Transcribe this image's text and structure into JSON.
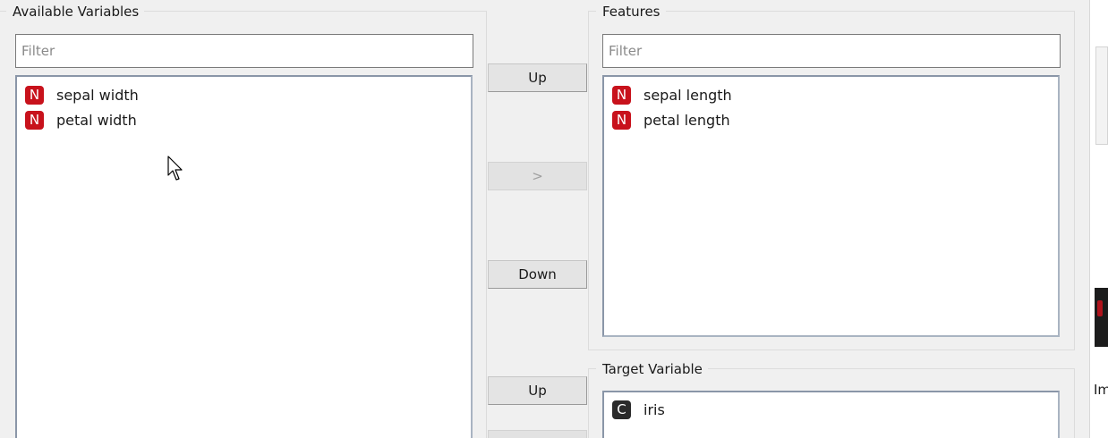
{
  "available": {
    "title": "Available Variables",
    "filter_placeholder": "Filter",
    "items": [
      {
        "badge": "N",
        "label": "sepal width"
      },
      {
        "badge": "N",
        "label": "petal width"
      }
    ]
  },
  "features": {
    "title": "Features",
    "filter_placeholder": "Filter",
    "items": [
      {
        "badge": "N",
        "label": "sepal length"
      },
      {
        "badge": "N",
        "label": "petal length"
      }
    ]
  },
  "target": {
    "title": "Target Variable",
    "items": [
      {
        "badge": "C",
        "label": "iris"
      }
    ]
  },
  "buttons": {
    "features_up": "Up",
    "features_move": ">",
    "features_down": "Down",
    "target_up": "Up"
  },
  "right_edge": {
    "text": "Im"
  },
  "colors": {
    "numeric_badge": "#c8121c",
    "categorical_badge": "#2b2b2b",
    "list_border": "#8a96a8"
  }
}
